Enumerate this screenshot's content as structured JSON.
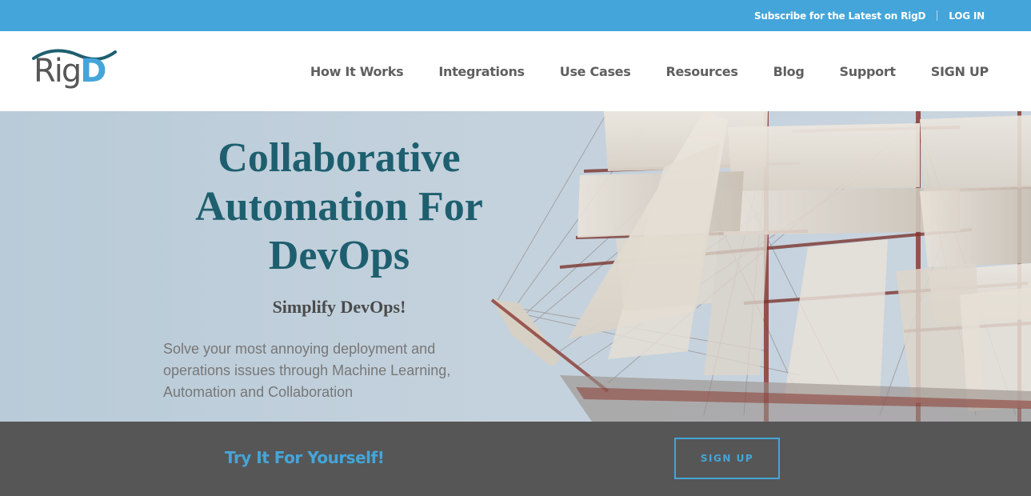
{
  "topbar": {
    "subscribe_label": "Subscribe for the Latest on RigD",
    "login_label": "LOG IN"
  },
  "brand": {
    "logo_prefix": "Rig",
    "logo_suffix": "D"
  },
  "nav": {
    "items": [
      {
        "label": "How It Works"
      },
      {
        "label": "Integrations"
      },
      {
        "label": "Use Cases"
      },
      {
        "label": "Resources"
      },
      {
        "label": "Blog"
      },
      {
        "label": "Support"
      },
      {
        "label": "SIGN UP"
      }
    ]
  },
  "hero": {
    "title": "Collaborative Automation For DevOps",
    "subtitle": "Simplify DevOps!",
    "description": "Solve your most annoying deployment and operations issues through Machine Learning, Automation and Collaboration",
    "background_image": "sailing-ship-icon"
  },
  "cta": {
    "text": "Try It For Yourself!",
    "button_label": "SIGN UP"
  },
  "colors": {
    "accent": "#44a5da",
    "title": "#1e5f6f",
    "cta_background": "#565656"
  }
}
